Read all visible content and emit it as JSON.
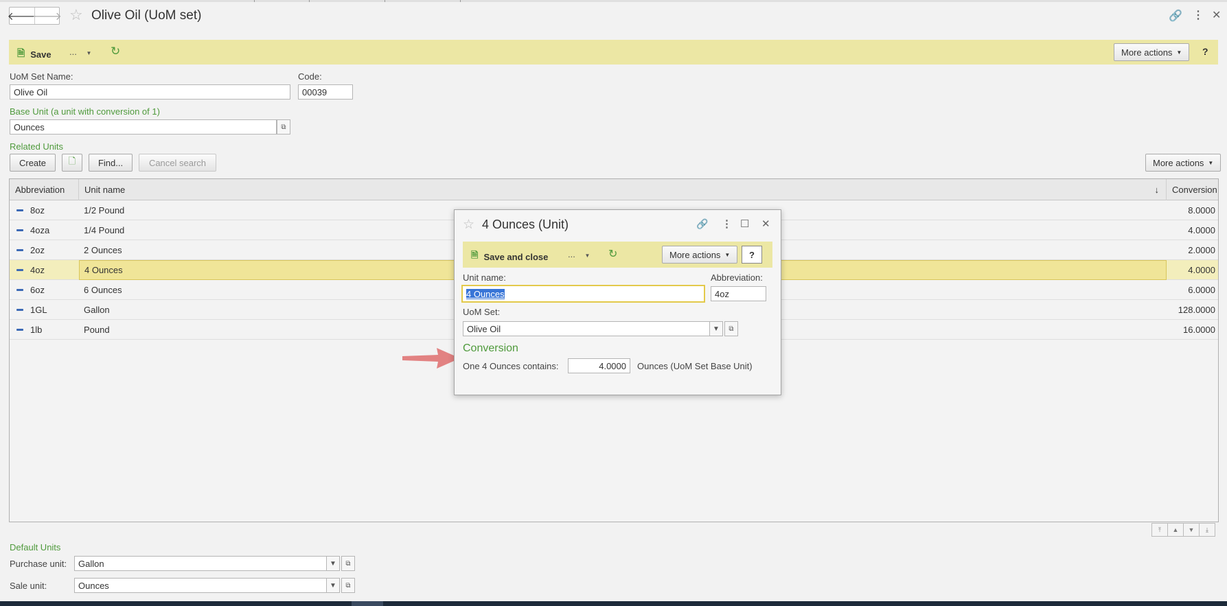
{
  "window": {
    "title": "Olive Oil (UoM set)"
  },
  "toolbar": {
    "save_label": "Save",
    "ellipsis_label": "...",
    "more_actions_label": "More actions",
    "help_label": "?"
  },
  "form": {
    "uom_set_name_label": "UoM Set Name:",
    "uom_set_name_value": "Olive Oil",
    "code_label": "Code:",
    "code_value": "00039",
    "base_unit_label": "Base Unit (a unit with conversion of 1)",
    "base_unit_value": "Ounces",
    "related_units_label": "Related Units"
  },
  "grid_toolbar": {
    "create_label": "Create",
    "find_label": "Find...",
    "cancel_search_label": "Cancel search",
    "more_actions_label": "More actions"
  },
  "grid": {
    "columns": [
      "Abbreviation",
      "Unit name",
      "Conversion"
    ],
    "sort_indicator": "↓",
    "rows": [
      {
        "abbreviation": "8oz",
        "unit_name": "1/2 Pound",
        "conversion": "8.0000",
        "selected": false
      },
      {
        "abbreviation": "4oza",
        "unit_name": "1/4 Pound",
        "conversion": "4.0000",
        "selected": false
      },
      {
        "abbreviation": "2oz",
        "unit_name": "2 Ounces",
        "conversion": "2.0000",
        "selected": false
      },
      {
        "abbreviation": "4oz",
        "unit_name": "4 Ounces",
        "conversion": "4.0000",
        "selected": true
      },
      {
        "abbreviation": "6oz",
        "unit_name": "6 Ounces",
        "conversion": "6.0000",
        "selected": false
      },
      {
        "abbreviation": "1GL",
        "unit_name": "Gallon",
        "conversion": "128.0000",
        "selected": false
      },
      {
        "abbreviation": "1lb",
        "unit_name": "Pound",
        "conversion": "16.0000",
        "selected": false
      }
    ]
  },
  "default_units": {
    "section_label": "Default Units",
    "purchase_label": "Purchase unit:",
    "purchase_value": "Gallon",
    "sale_label": "Sale unit:",
    "sale_value": "Ounces"
  },
  "dialog": {
    "title": "4 Ounces (Unit)",
    "save_close_label": "Save and close",
    "ellipsis_label": "...",
    "more_actions_label": "More actions",
    "help_label": "?",
    "unit_name_label": "Unit name:",
    "unit_name_value": "4 Ounces",
    "abbreviation_label": "Abbreviation:",
    "abbreviation_value": "4oz",
    "uom_set_label": "UoM Set:",
    "uom_set_value": "Olive Oil",
    "conversion_header": "Conversion",
    "conversion_prefix": "One 4 Ounces contains:",
    "conversion_value": "4.0000",
    "conversion_suffix": "Ounces (UoM Set Base Unit)"
  },
  "colors": {
    "command_bar": "#ece7a4",
    "section_green": "#4f9a3c",
    "selected_row": "#f3eebc",
    "annotation_arrow": "#e07575"
  }
}
